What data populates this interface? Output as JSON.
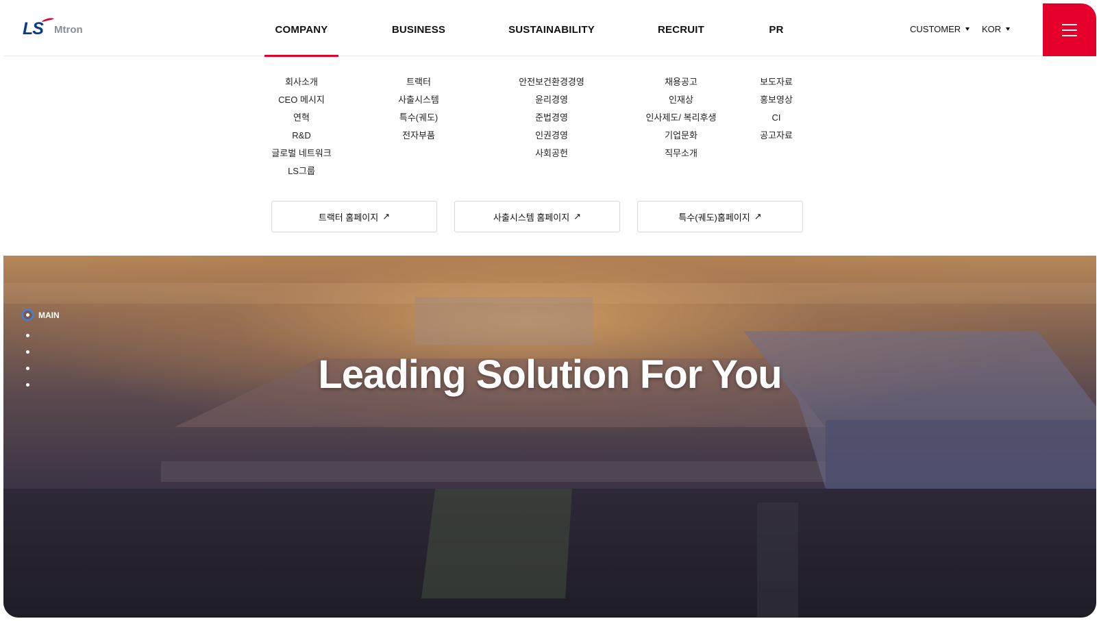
{
  "brand": {
    "mark": "LS",
    "word": "Mtron"
  },
  "gnb": [
    {
      "label": "COMPANY"
    },
    {
      "label": "BUSINESS"
    },
    {
      "label": "SUSTAINABILITY"
    },
    {
      "label": "RECRUIT"
    },
    {
      "label": "PR"
    }
  ],
  "utility": {
    "customer": "CUSTOMER",
    "language": "KOR"
  },
  "submenu": {
    "company": [
      "회사소개",
      "CEO 메시지",
      "연혁",
      "R&D",
      "글로벌 네트워크",
      "LS그룹"
    ],
    "business": [
      "트랙터",
      "사출시스템",
      "특수(궤도)",
      "전자부품"
    ],
    "sustainability": [
      "안전보건환경경영",
      "윤리경영",
      "준법경영",
      "인권경영",
      "사회공헌"
    ],
    "recruit": [
      "채용공고",
      "인재상",
      "인사제도/ 복리후생",
      "기업문화",
      "직무소개"
    ],
    "pr": [
      "보도자료",
      "홍보영상",
      "CI",
      "공고자료"
    ]
  },
  "site_links": [
    {
      "label": "트랙터 홈페이지"
    },
    {
      "label": "사출시스템 홈페이지"
    },
    {
      "label": "특수(궤도)홈페이지"
    }
  ],
  "hero": {
    "title": "Leading Solution For You",
    "side_nav_label": "MAIN"
  },
  "colors": {
    "accent": "#e4002b",
    "brand_blue": "#0a3b8c",
    "indicator": "#2c86ff"
  },
  "icons": {
    "menu": "hamburger-icon",
    "external": "external-link-icon",
    "caret": "caret-down-icon"
  }
}
